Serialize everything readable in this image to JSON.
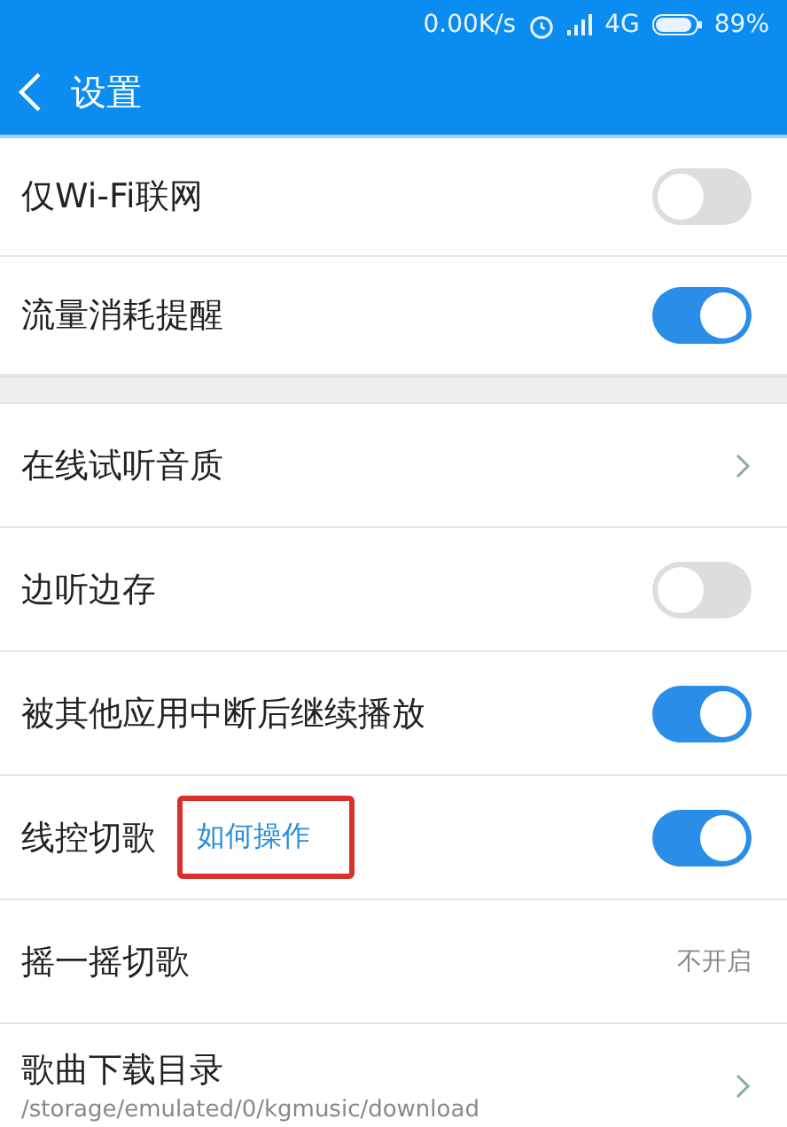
{
  "status_bar": {
    "speed": "0.00K/s",
    "network": "4G",
    "battery": "89%"
  },
  "header": {
    "title": "设置"
  },
  "groups": [
    {
      "items": [
        {
          "kind": "toggle",
          "label": "仅Wi-Fi联网",
          "on": false
        },
        {
          "kind": "toggle",
          "label": "流量消耗提醒",
          "on": true
        }
      ]
    },
    {
      "items": [
        {
          "kind": "link",
          "label": "在线试听音质"
        },
        {
          "kind": "toggle",
          "label": "边听边存",
          "on": false
        },
        {
          "kind": "toggle",
          "label": "被其他应用中断后继续播放",
          "on": true
        },
        {
          "kind": "toggle",
          "label": "线控切歌",
          "on": true,
          "help_link": {
            "text": "如何操作",
            "highlighted": true
          }
        },
        {
          "kind": "value",
          "label": "摇一摇切歌",
          "value": "不开启"
        },
        {
          "kind": "link",
          "label": "歌曲下载目录",
          "subtitle": "/storage/emulated/0/kgmusic/download"
        }
      ]
    }
  ]
}
